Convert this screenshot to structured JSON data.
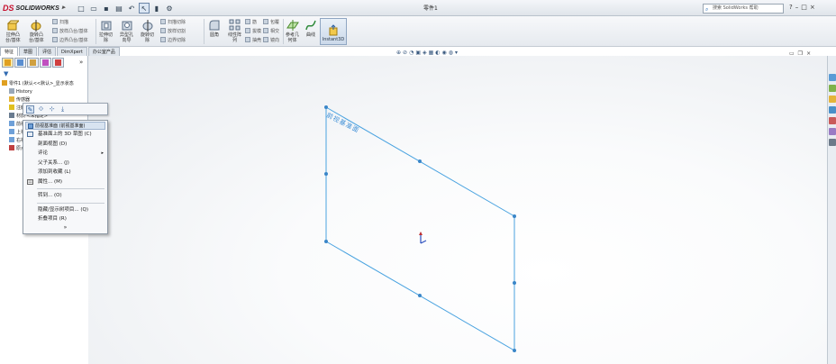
{
  "app": {
    "logo_text": "SOLIDWORKS",
    "window_title": "零件1",
    "search_placeholder": "搜索 SolidWorks 帮助",
    "title_controls": [
      "?",
      "–",
      "□",
      "×"
    ]
  },
  "quick_access": [
    "new-icon",
    "open-icon",
    "save-icon",
    "print-icon",
    "undo-icon",
    "select-icon",
    "rebuild-icon",
    "options-icon"
  ],
  "ribbon": {
    "large_buttons": [
      {
        "label_line1": "拉伸凸",
        "label_line2": "台/基体"
      },
      {
        "label_line1": "旋转凸",
        "label_line2": "台/基体"
      },
      {
        "label_line1": "拉伸切",
        "label_line2": "除"
      },
      {
        "label_line1": "异型孔",
        "label_line2": "向导"
      },
      {
        "label_line1": "旋转切",
        "label_line2": "除"
      },
      {
        "label_line1": "圆角",
        "label_line2": ""
      },
      {
        "label_line1": "线性阵",
        "label_line2": "列"
      },
      {
        "label_line1": "参考几",
        "label_line2": "何体"
      },
      {
        "label_line1": "曲线",
        "label_line2": ""
      }
    ],
    "small_col1": [
      "扫描",
      "放样凸台/基体",
      "边界凸台/基体"
    ],
    "small_col2": [
      "扫描切除",
      "放样切割",
      "边界切除"
    ],
    "small_col3": [
      "筋",
      "拔模",
      "抽壳"
    ],
    "small_col4": [
      "包覆",
      "相交",
      "镜向"
    ],
    "instant3d_label": "Instant3D"
  },
  "tabs": [
    "特征",
    "草图",
    "评估",
    "DimXpert",
    "办公室产品"
  ],
  "feature_tree": {
    "items": [
      {
        "label": "零件1 (默认<<默认>_显示状态"
      },
      {
        "label": "History"
      },
      {
        "label": "传感器"
      },
      {
        "label": "注解"
      },
      {
        "label": "材质 <未指定>"
      },
      {
        "label": "前视基准面"
      },
      {
        "label": "上视基准面"
      },
      {
        "label": "右视基准面"
      },
      {
        "label": "原点"
      }
    ]
  },
  "context_menu": {
    "header": "前视基准面 (前视基准面)",
    "items": [
      {
        "label": "基准面上的 3D 草图 (C)",
        "has_submenu": false
      },
      {
        "label": "剖面视图 (D)",
        "has_submenu": false
      },
      {
        "label": "评论",
        "has_submenu": true
      },
      {
        "label": "父子关系... (J)",
        "has_submenu": false
      },
      {
        "label": "添加到收藏 (L)",
        "has_submenu": false
      },
      {
        "label": "属性... (M)",
        "has_submenu": false
      },
      {
        "label": "转到... (O)",
        "has_submenu": false
      },
      {
        "label": "隐藏/显示树项目... (Q)",
        "has_submenu": false
      },
      {
        "label": "折叠项目 (R)",
        "has_submenu": false
      }
    ],
    "more": "»"
  },
  "plane_label": "前视基准面",
  "colors": {
    "accent": "#3a9ad9",
    "plane_edge": "#4aa3e0",
    "viewport_bg": "#f2f4f6"
  }
}
